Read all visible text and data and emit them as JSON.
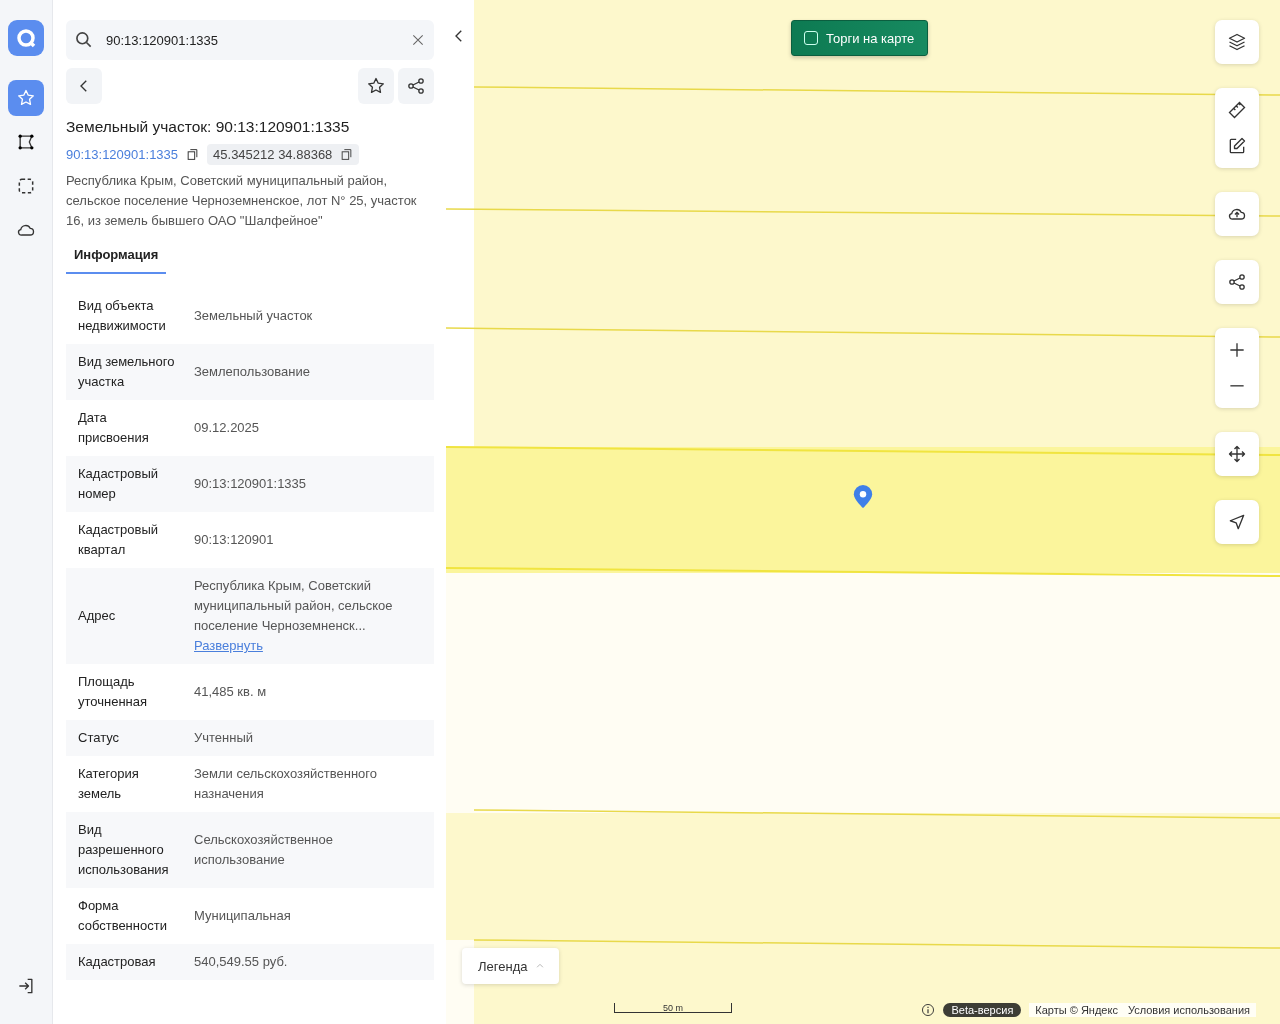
{
  "rail": {
    "items": [
      {
        "selected": true
      },
      {
        "selected": false
      },
      {
        "selected": false
      },
      {
        "selected": false
      }
    ]
  },
  "search": {
    "value": "90:13:120901:1335"
  },
  "object": {
    "title": "Земельный участок: 90:13:120901:1335",
    "cadastral_link": "90:13:120901:1335",
    "coordinates": "45.345212 34.88368",
    "address": "Республика Крым, Советский муниципальный район, сельское поселение Черноземненское, лот N° 25, участок 16, из земель бывшего ОАО \"Шалфейное\""
  },
  "tabs": [
    {
      "label": "Информация",
      "selected": true
    }
  ],
  "rows": [
    {
      "label": "Вид объекта недвижимости",
      "value": "Земельный участок"
    },
    {
      "label": "Вид земельного участка",
      "value": "Землепользование"
    },
    {
      "label": "Дата присвоения",
      "value": "09.12.2025"
    },
    {
      "label": "Кадастровый номер",
      "value": "90:13:120901:1335"
    },
    {
      "label": "Кадастровый квартал",
      "value": "90:13:120901"
    },
    {
      "label": "Адрес",
      "value": "Республика Крым, Советский муниципальный район, сельское поселение Черноземненск...",
      "link": "Развернуть"
    },
    {
      "label": "Площадь уточненная",
      "value": "41,485 кв. м"
    },
    {
      "label": "Статус",
      "value": "Учтенный"
    },
    {
      "label": "Категория земель",
      "value": "Земли сельскохозяйственного назначения"
    },
    {
      "label": "Вид разрешенного использования",
      "value": "Сельскохозяйственное использование"
    },
    {
      "label": "Форма собственности",
      "value": "Муниципальная"
    },
    {
      "label": "Кадастровая",
      "value": "540,549.55 руб."
    }
  ],
  "map": {
    "auction_toggle": {
      "label": "Торги на карте",
      "checked": false
    },
    "legend": "Легенда",
    "scale": "50 m",
    "beta": "Beta-версия",
    "copyright": "Карты © Яндекс",
    "terms": "Условия использования"
  }
}
